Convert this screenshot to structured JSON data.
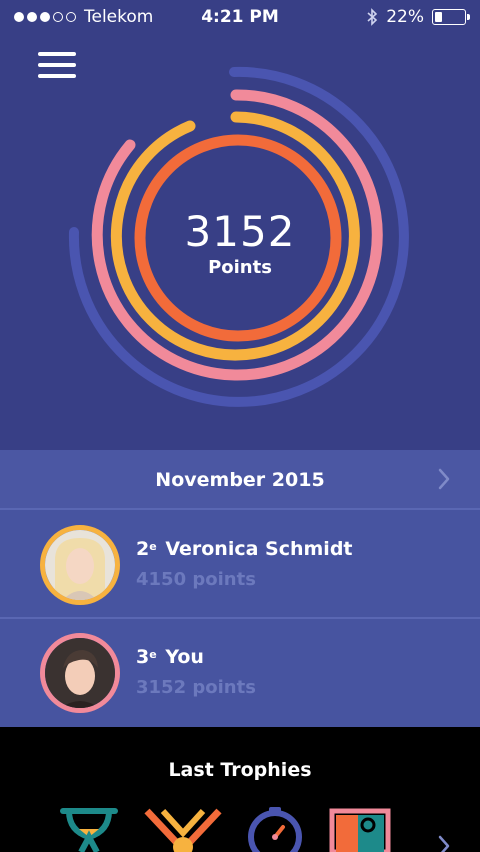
{
  "status_bar": {
    "carrier": "Telekom",
    "signal_bars_filled": 3,
    "signal_bars_total": 5,
    "time": "4:21 PM",
    "battery_percent": "22%",
    "battery_level": 0.22
  },
  "score": {
    "value": "3152",
    "label": "Points"
  },
  "rings": [
    {
      "name": "outer-blue",
      "color": "#4a55b0"
    },
    {
      "name": "pink",
      "color": "#f18a9a"
    },
    {
      "name": "yellow",
      "color": "#f7b23f"
    },
    {
      "name": "orange",
      "color": "#f26b3a"
    }
  ],
  "leaderboard": {
    "period": "November 2015",
    "entries": [
      {
        "rank": "2",
        "rank_suffix": "e",
        "name": "Veronica Schmidt",
        "points": "4150 points",
        "ring_color": "#f7b23f"
      },
      {
        "rank": "3",
        "rank_suffix": "e",
        "name": "You",
        "points": "3152 points",
        "ring_color": "#f18a9a"
      }
    ]
  },
  "trophies": {
    "title": "Last Trophies",
    "items": [
      {
        "icon": "hourglass-trophy-icon"
      },
      {
        "icon": "medal-trophy-icon"
      },
      {
        "icon": "stopwatch-trophy-icon"
      },
      {
        "icon": "door-trophy-icon"
      }
    ]
  },
  "colors": {
    "background_top": "#383f86",
    "list_background": "#4754a0",
    "muted_text": "#6c79bd",
    "accent_orange": "#f26b3a",
    "accent_yellow": "#f7b23f",
    "accent_pink": "#f18a9a",
    "accent_blue": "#4a55b0",
    "accent_teal": "#1d8a8a"
  }
}
